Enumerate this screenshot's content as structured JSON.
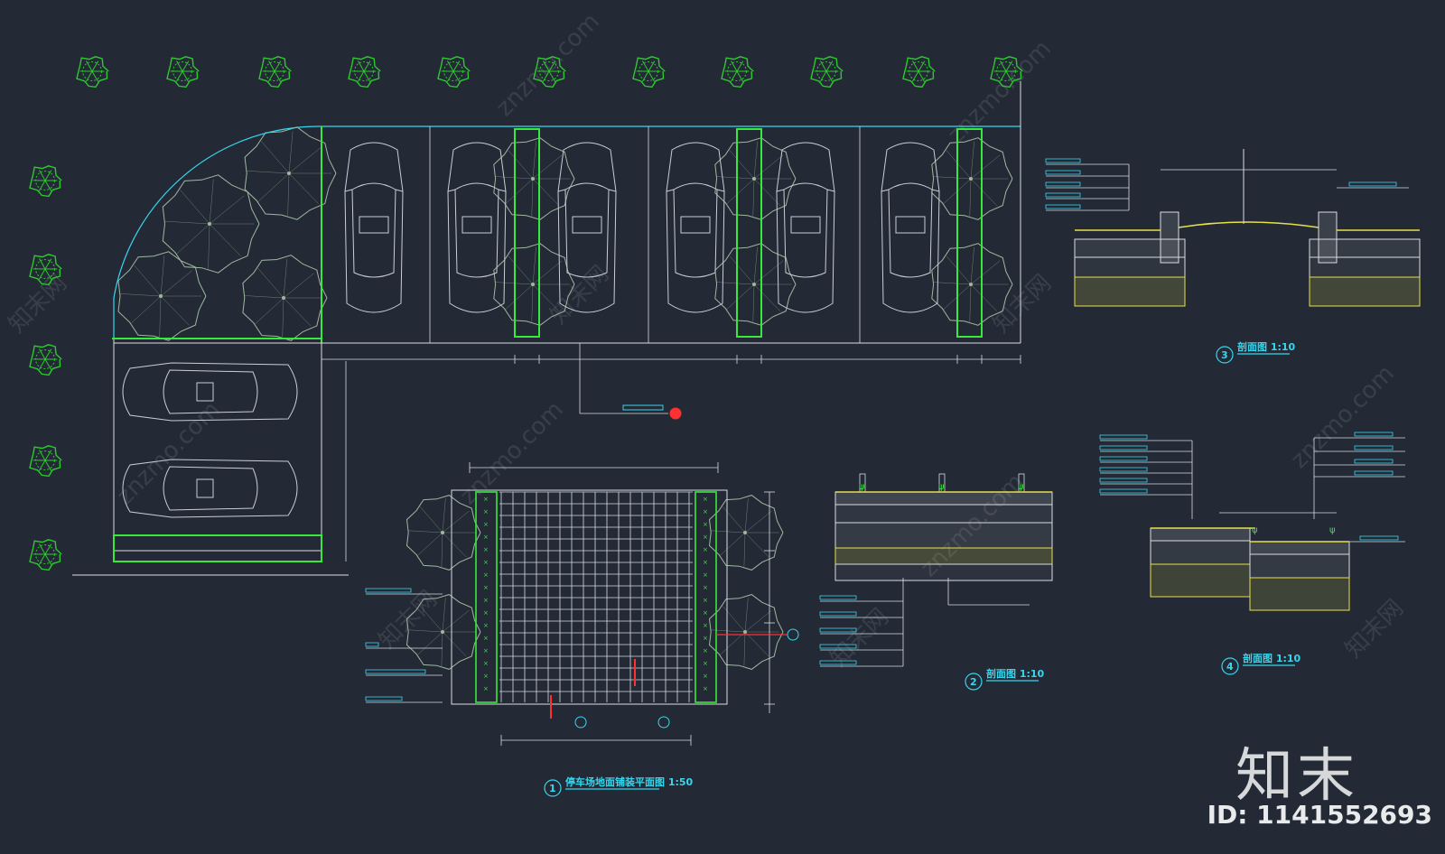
{
  "drawing": {
    "watermark_site": "znzmo.com",
    "watermark_cn": "知末网",
    "logo_text": "知末",
    "id_text": "ID: 1141552693"
  },
  "titles": {
    "plan": "停车场地面铺装平面图 1:50",
    "plan_no": "1",
    "section2": "剖面图 1:10",
    "section2_no": "2",
    "section3": "剖面图 1:10",
    "section3_no": "3",
    "section4": "剖面图 1:10",
    "section4_no": "4"
  },
  "colors": {
    "background": "#232a36",
    "tree": "#2ec92e",
    "car": "#c9ced6",
    "green_line": "#38e83a",
    "cyan": "#36d6ee",
    "yellow": "#e6e04a",
    "white_line": "#d8dce2",
    "red": "#ff3030"
  }
}
